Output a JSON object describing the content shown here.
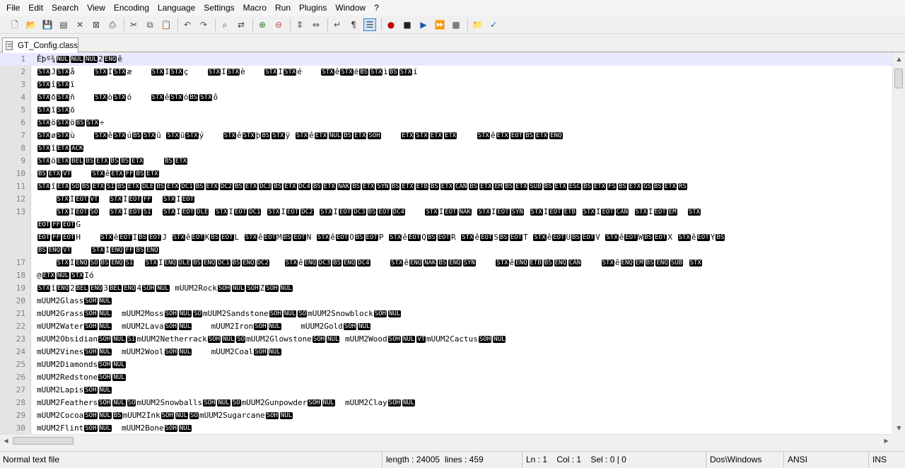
{
  "menu": [
    "File",
    "Edit",
    "Search",
    "View",
    "Encoding",
    "Language",
    "Settings",
    "Macro",
    "Run",
    "Plugins",
    "Window",
    "?"
  ],
  "toolbar": {
    "groups": [
      [
        "new-file-icon",
        "open-file-icon",
        "save-icon",
        "save-all-icon",
        "close-icon",
        "close-all-icon",
        "print-icon"
      ],
      [
        "cut-icon",
        "copy-icon",
        "paste-icon"
      ],
      [
        "undo-icon",
        "redo-icon"
      ],
      [
        "find-icon",
        "replace-icon"
      ],
      [
        "zoom-in-icon",
        "zoom-out-icon"
      ],
      [
        "sync-vertical-icon",
        "sync-horizontal-icon"
      ],
      [
        "word-wrap-icon",
        "show-all-chars-icon",
        "indent-guide-icon"
      ],
      [
        "record-macro-icon",
        "stop-recording-icon",
        "play-macro-icon",
        "run-macro-multiple-icon",
        "save-macro-icon"
      ],
      [
        "folder-workspace-icon",
        "spell-check-icon"
      ]
    ],
    "active": "indent-guide-icon"
  },
  "tab": {
    "title": "GT_Config.class"
  },
  "editor": {
    "current_line": 1,
    "lines": [
      {
        "n": "1",
        "t": "Êþº¾[NUL][NUL][NUL]2[ENQ]ê"
      },
      {
        "n": "2",
        "t": "[STX]J[STX]å    [STX]I[STX]æ    [STX]I[STX]ç    [STX]I[STX]è    [STX]I[STX]é    [STX]ê[STX]ë[BS][STX]ì[BS][STX]í"
      },
      {
        "n": "3",
        "t": "[STX]î[STX]ï"
      },
      {
        "n": "4",
        "t": "[STX]ð[STX]ñ    [STX]ò[STX]ó    [STX]ê[STX]ó[BS][STX]ô"
      },
      {
        "n": "5",
        "t": "[STX]î[STX]õ"
      },
      {
        "n": "6",
        "t": "[STX]ö[STX]ö[BS][STX]÷"
      },
      {
        "n": "7",
        "t": "[STX]ø[STX]ù    [STX]ê[STX]ú[BS][STX]û [STX]ü[STX]ý    [STX]ê[STX]þ[BS][STX]ÿ [STX]ê[ETX][NUL][BS][ETX][SOH]    [ETX][STX][ETX][ETX]    [STX]ê[ETX][EOT][BS][ETX][ENQ]"
      },
      {
        "n": "8",
        "t": "[STX]î[ETX][ACK]"
      },
      {
        "n": "9",
        "t": "[STX]ö[ETX][BEL][BS][ETX][BS][BS][ETX]    [BS][ETX]"
      },
      {
        "n": "10",
        "t": "[BS][ETX][VT]    [STX]ê[ETX][FF][BS][ETX]"
      },
      {
        "n": "11",
        "t": "[STX]î[ETX][SO][BS][ETX][SI][BS][ETX][DLE][BS][ETX][DC1][BS][ETX][DC2][BS][ETX][DC3][BS][ETX][DC4][BS][ETX][NAK][BS][ETX][SYN][BS][ETX][ETB][BS][ETX][CAN][BS][ETX][EM][BS][ETX][SUB][BS][ETX][ESC][BS][ETX][FS][BS][ETX][GS][BS][ETX][RS]"
      },
      {
        "n": "12",
        "t": "    [STX]I[EOT][VT]  [STX]I[EOT][FF]  [STX]I[EOT]"
      },
      {
        "n": "13",
        "t": "    [STX]I[EOT][SO]  [STX]I[EOT][SI]  [STX]I[EOT][DLE] [STX]I[EOT][DC1] [STX]I[EOT][DC2] [STX]I[EOT][DC3][BS][EOT][DC4]    [STX]I[EOT][NAK] [STX]I[EOT][SYN] [STX]I[EOT][ETB] [STX]I[EOT][CAN] [STX]I[EOT][EM]  [STX]"
      },
      {
        "n": "",
        "t": "[EOT][FF][EOT]G"
      },
      {
        "n": "",
        "t": "[EOT][FF][EOT]H    [STX]ê[EOT]I[BS][EOT]J [STX]ê[EOT]K[BS][EOT]L [STX]ê[EOT]M[BS][EOT]N [STX]ê[EOT]O[BS][EOT]P [STX]ê[EOT]Q[BS][EOT]R [STX]ê[EOT]S[BS][EOT]T [STX]ê[EOT]U[BS][EOT]V [STX]ê[EOT]W[BS][EOT]X [STX]ê[EOT]Y[BS]"
      },
      {
        "n": "",
        "t": "[BS][ENQ][VT]    [STX]I[ENQ][FF][BS][ENQ]"
      },
      {
        "n": "17",
        "t": "    [STX]I[ENQ][SO][BS][ENQ][SI]  [STX]I[ENQ][DLE][BS][ENQ][DC1][BS][ENQ][DC2]   [STX]ê[ENQ][DC3][BS][ENQ][DC4]    [STX]ê[ENQ][NAK][BS][ENQ][SYN]    [STX]ê[ENQ][ETB][BS][ENQ][CAN]    [STX]ê[ENQ][EM][BS][ENQ][SUB] [STX]"
      },
      {
        "n": "18",
        "t": "@[ETX][NUL][STX]Ió"
      },
      {
        "n": "19",
        "t": "[STX]î[ENQ]2[BEL][ENQ]3[BEL][ENQ]4[SOH][NUL] mUUM2Rock[SOH][NUL][SOH]Z[SOH][NUL]"
      },
      {
        "n": "20",
        "t": "mUUM2Glass[SOH][NUL]"
      },
      {
        "n": "21",
        "t": "mUUM2Grass[SOH][NUL]  mUUM2Moss[SOH][NUL][SO]mUUM2Sandstone[SOH][NUL][SO]mUUM2Snowblock[SOH][NUL]"
      },
      {
        "n": "22",
        "t": "mUUM2Water[SOH][NUL]  mUUM2Lava[SOH][NUL]    mUUM2Iron[SOH][NUL]    mUUM2Gold[SOH][NUL]"
      },
      {
        "n": "23",
        "t": "mUUM2Obsidian[SOH][NUL][SI]mUUM2Netherrack[SOH][NUL][SO]mUUM2Glowstone[SOH][NUL] mUUM2Wood[SOH][NUL][VT]mUUM2Cactus[SOH][NUL]"
      },
      {
        "n": "24",
        "t": "mUUM2Vines[SOH][NUL]  mUUM2Wool[SOH][NUL]    mUUM2Coal[SOH][NUL]"
      },
      {
        "n": "25",
        "t": "mUUM2Diamonds[SOH][NUL]"
      },
      {
        "n": "26",
        "t": "mUUM2Redstone[SOH][NUL]"
      },
      {
        "n": "27",
        "t": "mUUM2Lapis[SOH][NUL]"
      },
      {
        "n": "28",
        "t": "mUUM2Feathers[SOH][NUL][SO]mUUM2Snowballs[SOH][NUL][SO]mUUM2Gunpowder[SOH][NUL]  mUUM2Clay[SOH][NUL]"
      },
      {
        "n": "29",
        "t": "mUUM2Cocoa[SOH][NUL][BS]mUUM2Ink[SOH][NUL][SO]mUUM2Sugarcane[SOH][NUL]"
      },
      {
        "n": "30",
        "t": "mUUM2Flint[SOH][NUL]  mUUM2Bone[SOH][NUL]"
      }
    ]
  },
  "status": {
    "file_type": "Normal text file",
    "length": "length : 24005",
    "lines": "lines : 459",
    "position": "Ln : 1    Col : 1    Sel : 0 | 0",
    "eol": "Dos\\Windows",
    "encoding": "ANSI",
    "mode": "INS"
  }
}
